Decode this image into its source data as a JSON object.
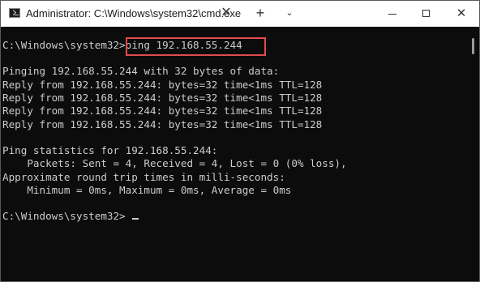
{
  "window": {
    "title": "Administrator: C:\\Windows\\system32\\cmd.exe",
    "tab_close": "✕",
    "tab_add": "+",
    "tab_dropdown": "⌄",
    "close": "✕"
  },
  "terminal": {
    "lines": [
      "C:\\Windows\\system32>ping 192.168.55.244",
      "",
      "Pinging 192.168.55.244 with 32 bytes of data:",
      "Reply from 192.168.55.244: bytes=32 time<1ms TTL=128",
      "Reply from 192.168.55.244: bytes=32 time<1ms TTL=128",
      "Reply from 192.168.55.244: bytes=32 time<1ms TTL=128",
      "Reply from 192.168.55.244: bytes=32 time<1ms TTL=128",
      "",
      "Ping statistics for 192.168.55.244:",
      "    Packets: Sent = 4, Received = 4, Lost = 0 (0% loss),",
      "Approximate round trip times in milli-seconds:",
      "    Minimum = 0ms, Maximum = 0ms, Average = 0ms",
      "",
      "C:\\Windows\\system32>"
    ]
  },
  "colors": {
    "background": "#0c0c0c",
    "text": "#cccccc",
    "highlight_border": "#e04b4b",
    "titlebar": "#ffffff"
  },
  "icons": {
    "app": "cmd-icon"
  }
}
